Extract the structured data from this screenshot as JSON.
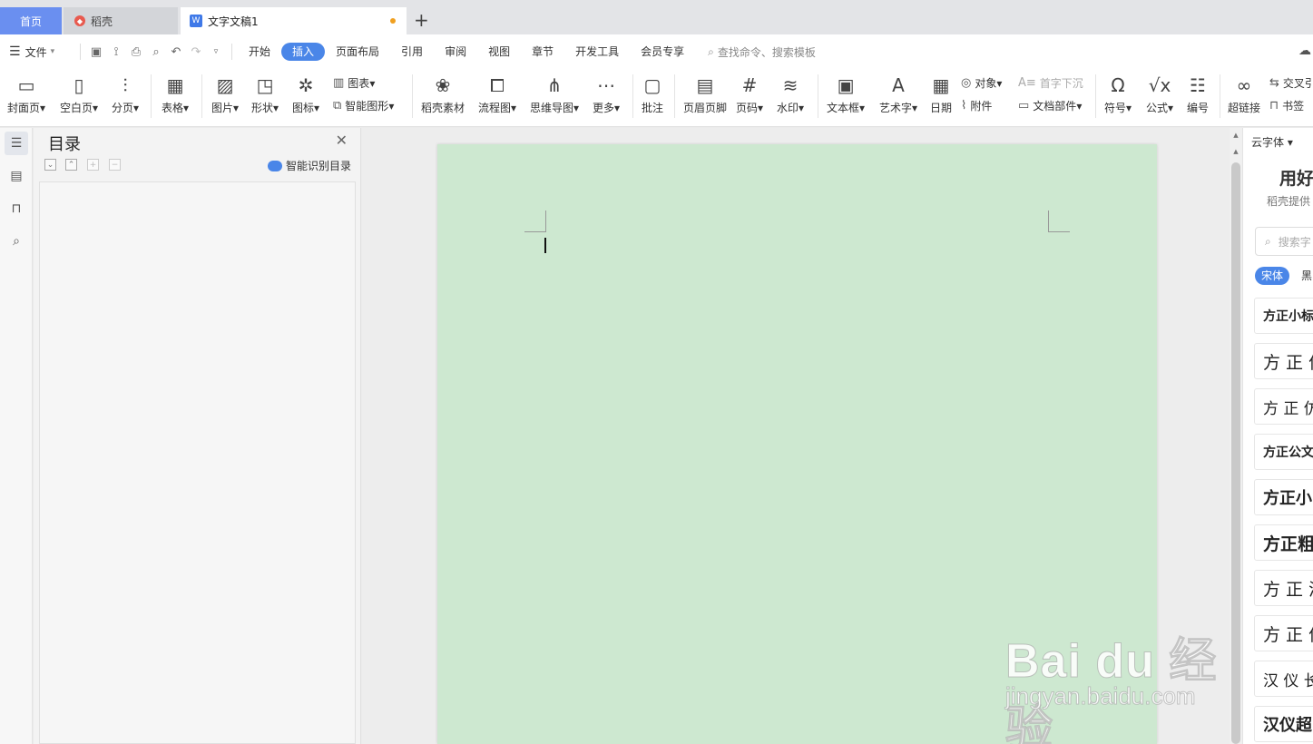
{
  "tabs": {
    "home": "首页",
    "daoke": "稻壳",
    "document": "文字文稿1"
  },
  "menu": {
    "file": "文件",
    "tabs": [
      "开始",
      "插入",
      "页面布局",
      "引用",
      "审阅",
      "视图",
      "章节",
      "开发工具",
      "会员专享"
    ],
    "active_tab": "插入",
    "search_placeholder": "查找命令、搜索模板"
  },
  "ribbon": {
    "cover_page": "封面页",
    "blank_page": "空白页",
    "page_break": "分页",
    "table": "表格",
    "picture": "图片",
    "shape": "形状",
    "icon": "图标",
    "chart": "图表",
    "smart_shape": "智能图形",
    "daoke_material": "稻壳素材",
    "flowchart": "流程图",
    "mindmap": "思维导图",
    "more": "更多",
    "comment": "批注",
    "header_footer": "页眉页脚",
    "page_number": "页码",
    "watermark": "水印",
    "textbox": "文本框",
    "wordart": "艺术字",
    "date": "日期",
    "object": "对象",
    "attachment": "附件",
    "drop_cap": "首字下沉",
    "doc_parts": "文档部件",
    "symbol": "符号",
    "formula": "公式",
    "numbering": "编号",
    "hyperlink": "超链接",
    "cross_ref": "交叉引",
    "bookmark": "书签"
  },
  "toc": {
    "title": "目录",
    "smart_detect": "智能识别目录"
  },
  "font_panel": {
    "cloud_fonts": "云字体",
    "title": "用好",
    "subtitle": "稻壳提供",
    "search_placeholder": "搜索字",
    "chip_active": "宋体",
    "chip_other": "黑",
    "fonts": [
      "方正小标",
      "方 正 仿",
      "方 正 仿",
      "方正公文",
      "方正小",
      "方正粗",
      "方 正 清",
      "方 正 仿",
      "汉 仪 长",
      "汉仪超"
    ]
  },
  "watermark": {
    "logo": "Bai du 经验",
    "url": "jingyan.baidu.com"
  },
  "colors": {
    "accent": "#4a86e8",
    "home_tab": "#6a8ff0",
    "page_bg": "#cde8d0",
    "modified_dot": "#f0a020"
  }
}
